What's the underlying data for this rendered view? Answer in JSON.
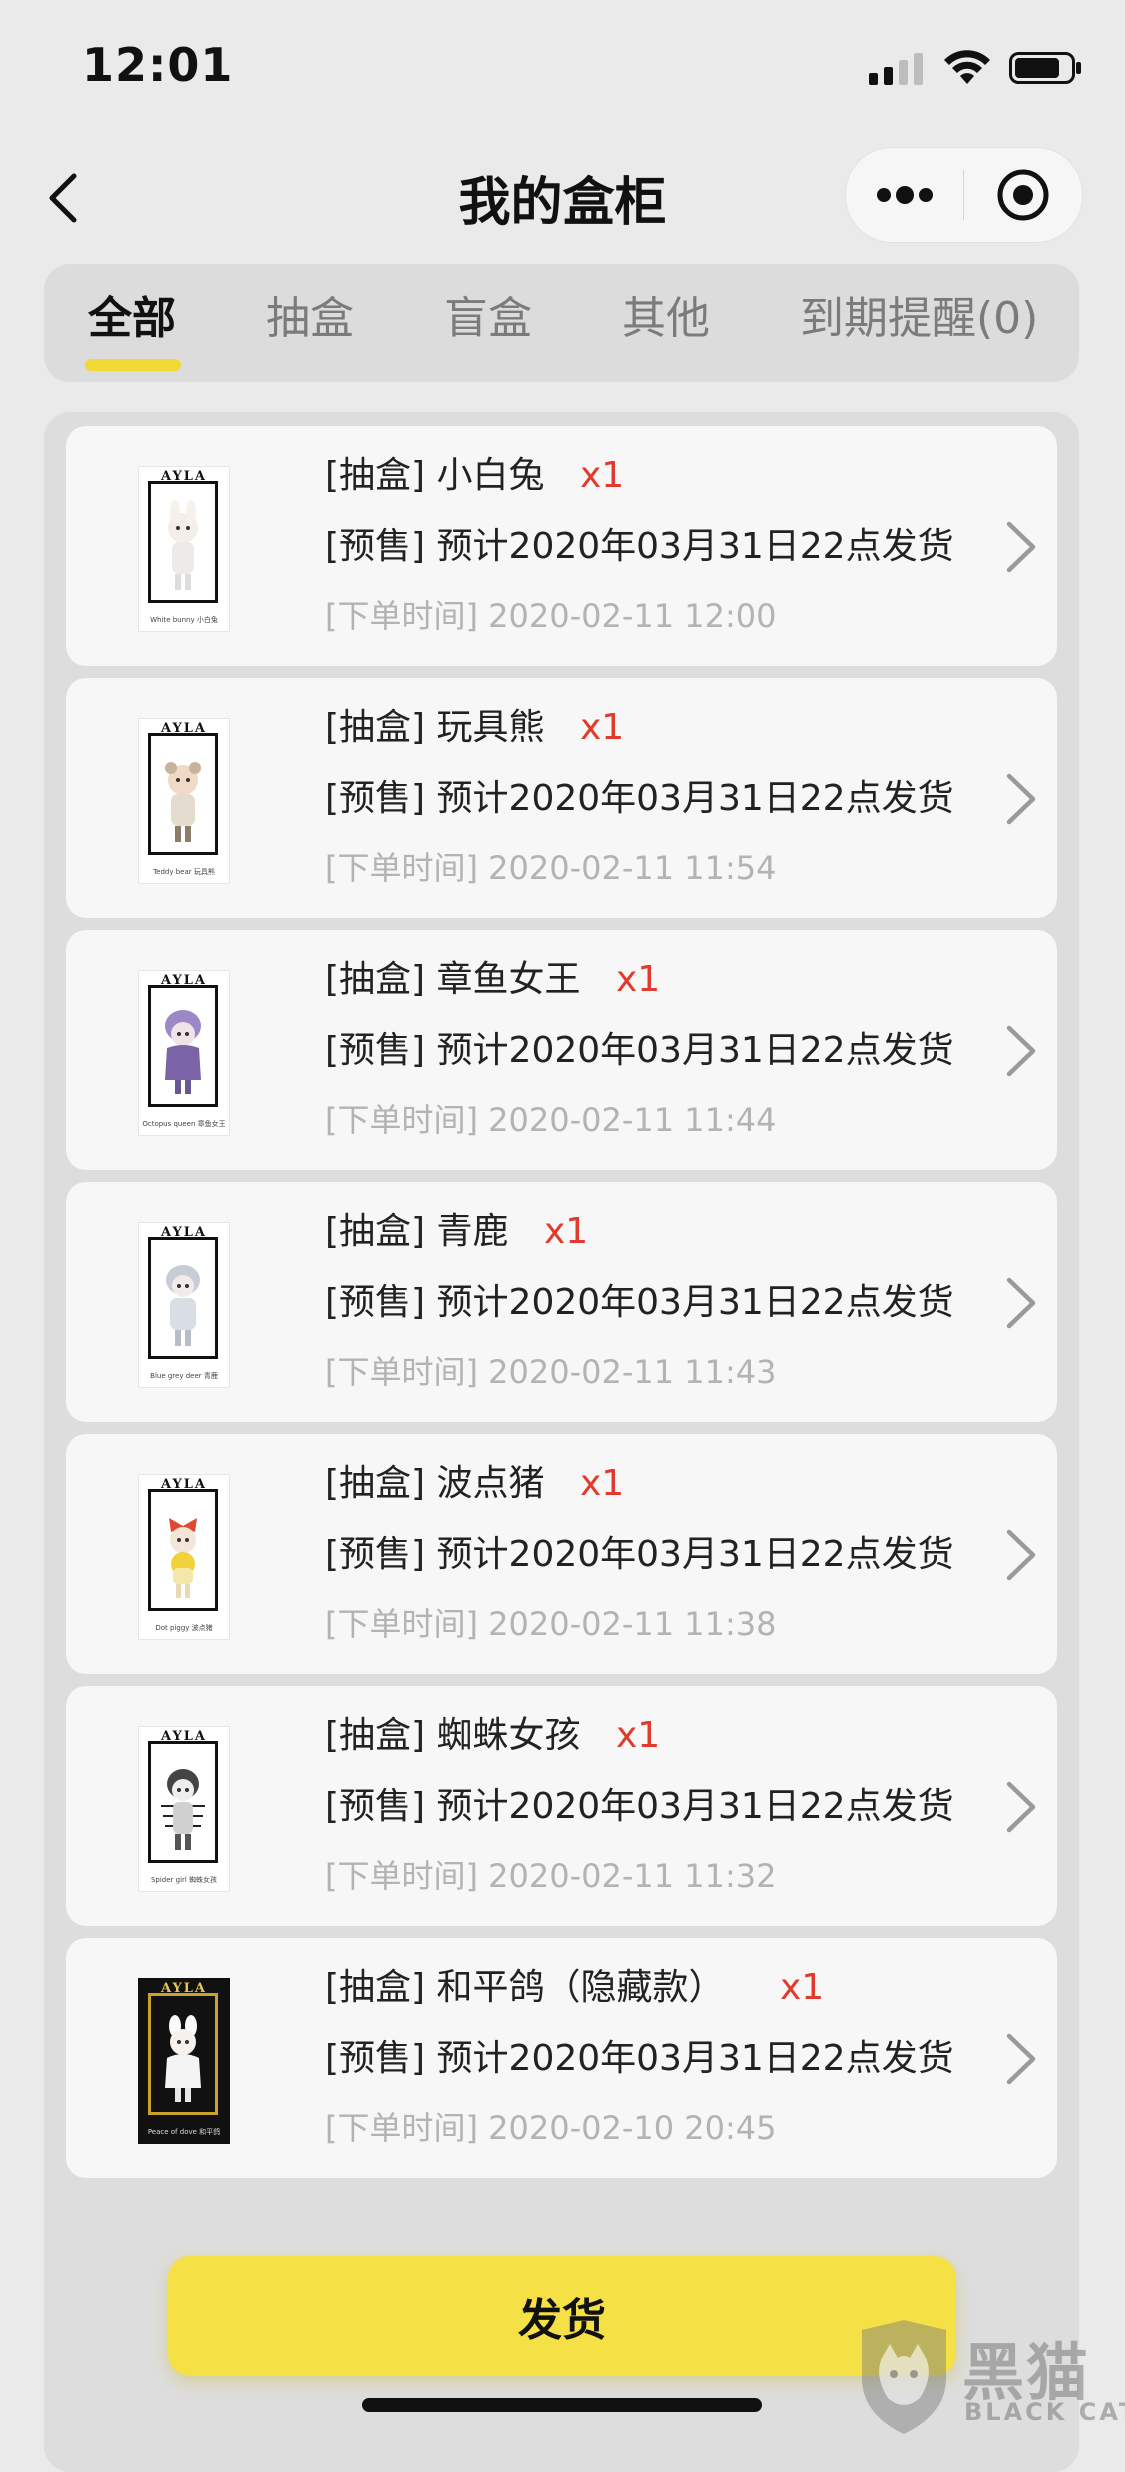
{
  "status_bar": {
    "time": "12:01",
    "signal_icon": "cellular-signal-icon",
    "wifi_icon": "wifi-icon",
    "battery_icon": "battery-icon"
  },
  "nav": {
    "back_icon": "chevron-left-icon",
    "title": "我的盒柜",
    "more_icon": "more-dots-icon",
    "close_icon": "target-close-icon"
  },
  "tabs": [
    {
      "label": "全部",
      "active": true
    },
    {
      "label": "抽盒",
      "active": false
    },
    {
      "label": "盲盒",
      "active": false
    },
    {
      "label": "其他",
      "active": false
    },
    {
      "label": "到期提醒(0)",
      "active": false
    }
  ],
  "orders": [
    {
      "name": "[抽盒] 小白兔",
      "qty": "x1",
      "presale": "[预售] 预计2020年03月31日22点发货",
      "order_time": "[下单时间] 2020-02-11 12:00",
      "thumb_brand": "AYLA",
      "thumb_caption": "White bunny 小白兔"
    },
    {
      "name": "[抽盒] 玩具熊",
      "qty": "x1",
      "presale": "[预售] 预计2020年03月31日22点发货",
      "order_time": "[下单时间] 2020-02-11 11:54",
      "thumb_brand": "AYLA",
      "thumb_caption": "Teddy bear 玩具熊"
    },
    {
      "name": "[抽盒] 章鱼女王",
      "qty": "x1",
      "presale": "[预售] 预计2020年03月31日22点发货",
      "order_time": "[下单时间] 2020-02-11 11:44",
      "thumb_brand": "AYLA",
      "thumb_caption": "Octopus queen 章鱼女王"
    },
    {
      "name": "[抽盒] 青鹿",
      "qty": "x1",
      "presale": "[预售] 预计2020年03月31日22点发货",
      "order_time": "[下单时间] 2020-02-11 11:43",
      "thumb_brand": "AYLA",
      "thumb_caption": "Blue grey deer 青鹿"
    },
    {
      "name": "[抽盒] 波点猪",
      "qty": "x1",
      "presale": "[预售] 预计2020年03月31日22点发货",
      "order_time": "[下单时间] 2020-02-11 11:38",
      "thumb_brand": "AYLA",
      "thumb_caption": "Dot piggy 波点猪"
    },
    {
      "name": "[抽盒] 蜘蛛女孩",
      "qty": "x1",
      "presale": "[预售] 预计2020年03月31日22点发货",
      "order_time": "[下单时间] 2020-02-11 11:32",
      "thumb_brand": "AYLA",
      "thumb_caption": "Spider girl 蜘蛛女孩"
    },
    {
      "name": "[抽盒] 和平鸽（隐藏款）",
      "qty": "x1",
      "presale": "[预售] 预计2020年03月31日22点发货",
      "order_time": "[下单时间] 2020-02-10 20:45",
      "thumb_brand": "AYLA",
      "thumb_caption": "Peace of dove 和平鸽"
    }
  ],
  "ship_button": "发货",
  "watermark": {
    "cn": "黑猫",
    "en": "BLACK CAT"
  },
  "colors": {
    "accent_yellow": "#f5e046",
    "qty_red": "#e23b2e",
    "muted_text": "#b3b3b3"
  }
}
